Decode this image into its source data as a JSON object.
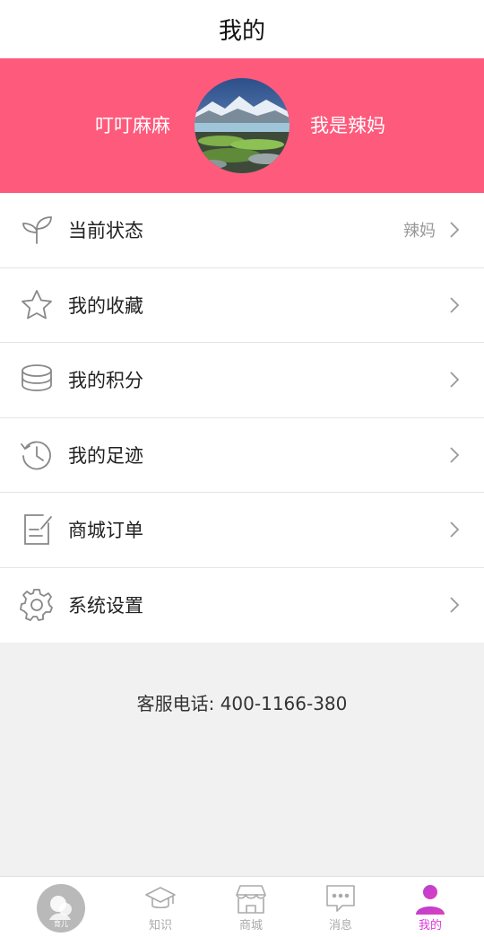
{
  "header": {
    "title": "我的"
  },
  "profile": {
    "nickname": "叮叮麻麻",
    "role": "我是辣妈",
    "avatar_icon": "landscape-avatar"
  },
  "menu": [
    {
      "icon": "sprout-icon",
      "label": "当前状态",
      "value": "辣妈"
    },
    {
      "icon": "star-icon",
      "label": "我的收藏",
      "value": ""
    },
    {
      "icon": "coins-icon",
      "label": "我的积分",
      "value": ""
    },
    {
      "icon": "history-icon",
      "label": "我的足迹",
      "value": ""
    },
    {
      "icon": "order-icon",
      "label": "商城订单",
      "value": ""
    },
    {
      "icon": "gear-icon",
      "label": "系统设置",
      "value": ""
    }
  ],
  "hotline": {
    "text": "客服电话: 400-1166-380"
  },
  "tabbar": {
    "items": [
      {
        "icon": "baby-home-icon",
        "label": "",
        "badge_text": "育儿"
      },
      {
        "icon": "graduation-cap-icon",
        "label": "知识"
      },
      {
        "icon": "store-icon",
        "label": "商城"
      },
      {
        "icon": "message-icon",
        "label": "消息"
      },
      {
        "icon": "person-icon",
        "label": "我的"
      }
    ],
    "active_color": "#d83bd9",
    "inactive_color": "#aaaaaa"
  },
  "colors": {
    "banner": "#fe5a7c",
    "background": "#f1f1f1"
  }
}
